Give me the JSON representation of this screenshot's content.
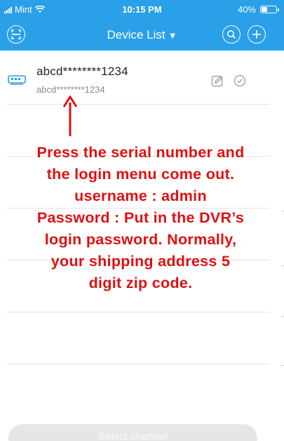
{
  "status_bar": {
    "carrier": "Mint",
    "time": "10:15 PM",
    "battery_text": "40%",
    "battery_level": 0.4
  },
  "nav": {
    "title": "Device List",
    "caret": "▼",
    "icons": [
      "scan-icon",
      "search-icon",
      "add-icon"
    ]
  },
  "device": {
    "name": "abcd********1234",
    "serial": "abcd********1234",
    "icons": [
      "dvr-device-icon",
      "edit-icon",
      "check-circle-icon"
    ]
  },
  "annotation": {
    "lines": [
      "Press the serial number and",
      "the login menu come out.",
      "username : admin",
      "Password : Put in the DVR’s",
      "login password. Normally,",
      "your shipping address 5",
      "digit zip code."
    ],
    "color": "#e01010"
  },
  "footer": {
    "select_channel_label": "Select channel"
  },
  "colors": {
    "accent": "#2aa0e8",
    "annotation_red": "#e01010"
  }
}
